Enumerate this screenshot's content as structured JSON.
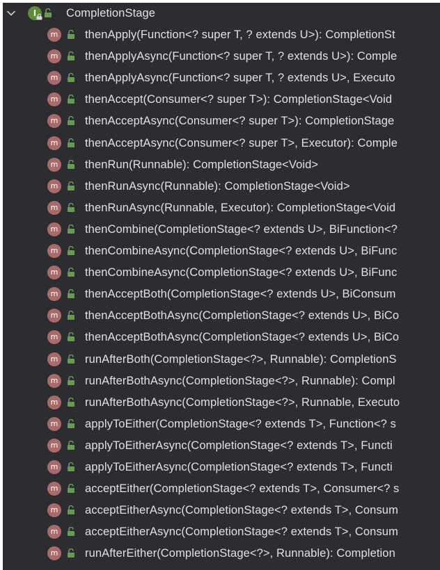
{
  "tree": {
    "root": {
      "label": "CompletionStage",
      "badge_letter": "I"
    },
    "method_badge_letter": "m",
    "members": [
      {
        "signature": "thenApply(Function<? super T, ? extends U>): CompletionSt"
      },
      {
        "signature": "thenApplyAsync(Function<? super T, ? extends U>): Comple"
      },
      {
        "signature": "thenApplyAsync(Function<? super T, ? extends U>, Executo"
      },
      {
        "signature": "thenAccept(Consumer<? super T>): CompletionStage<Void"
      },
      {
        "signature": "thenAcceptAsync(Consumer<? super T>): CompletionStage"
      },
      {
        "signature": "thenAcceptAsync(Consumer<? super T>, Executor): Comple"
      },
      {
        "signature": "thenRun(Runnable): CompletionStage<Void>"
      },
      {
        "signature": "thenRunAsync(Runnable): CompletionStage<Void>"
      },
      {
        "signature": "thenRunAsync(Runnable, Executor): CompletionStage<Void"
      },
      {
        "signature": "thenCombine(CompletionStage<? extends U>, BiFunction<?"
      },
      {
        "signature": "thenCombineAsync(CompletionStage<? extends U>, BiFunc"
      },
      {
        "signature": "thenCombineAsync(CompletionStage<? extends U>, BiFunc"
      },
      {
        "signature": "thenAcceptBoth(CompletionStage<? extends U>, BiConsum"
      },
      {
        "signature": "thenAcceptBothAsync(CompletionStage<? extends U>, BiCo"
      },
      {
        "signature": "thenAcceptBothAsync(CompletionStage<? extends U>, BiCo"
      },
      {
        "signature": "runAfterBoth(CompletionStage<?>, Runnable): CompletionS"
      },
      {
        "signature": "runAfterBothAsync(CompletionStage<?>, Runnable): Compl"
      },
      {
        "signature": "runAfterBothAsync(CompletionStage<?>, Runnable, Executo"
      },
      {
        "signature": "applyToEither(CompletionStage<? extends T>, Function<? s"
      },
      {
        "signature": "applyToEitherAsync(CompletionStage<? extends T>, Functi"
      },
      {
        "signature": "applyToEitherAsync(CompletionStage<? extends T>, Functi"
      },
      {
        "signature": "acceptEither(CompletionStage<? extends T>, Consumer<? s"
      },
      {
        "signature": "acceptEitherAsync(CompletionStage<? extends T>, Consum"
      },
      {
        "signature": "acceptEitherAsync(CompletionStage<? extends T>, Consum"
      },
      {
        "signature": "runAfterEither(CompletionStage<?>, Runnable): Completion"
      }
    ]
  },
  "icons": {
    "expand": "chevron-down-icon",
    "interface": "interface-icon",
    "method": "method-icon",
    "visibility": "public-visibility-icon"
  },
  "colors": {
    "background": "#2b2d30",
    "text": "#dfe1e5",
    "interface_badge": "#5f8b3c",
    "method_badge": "#a96a6a",
    "public_visibility": "#6a9955"
  }
}
